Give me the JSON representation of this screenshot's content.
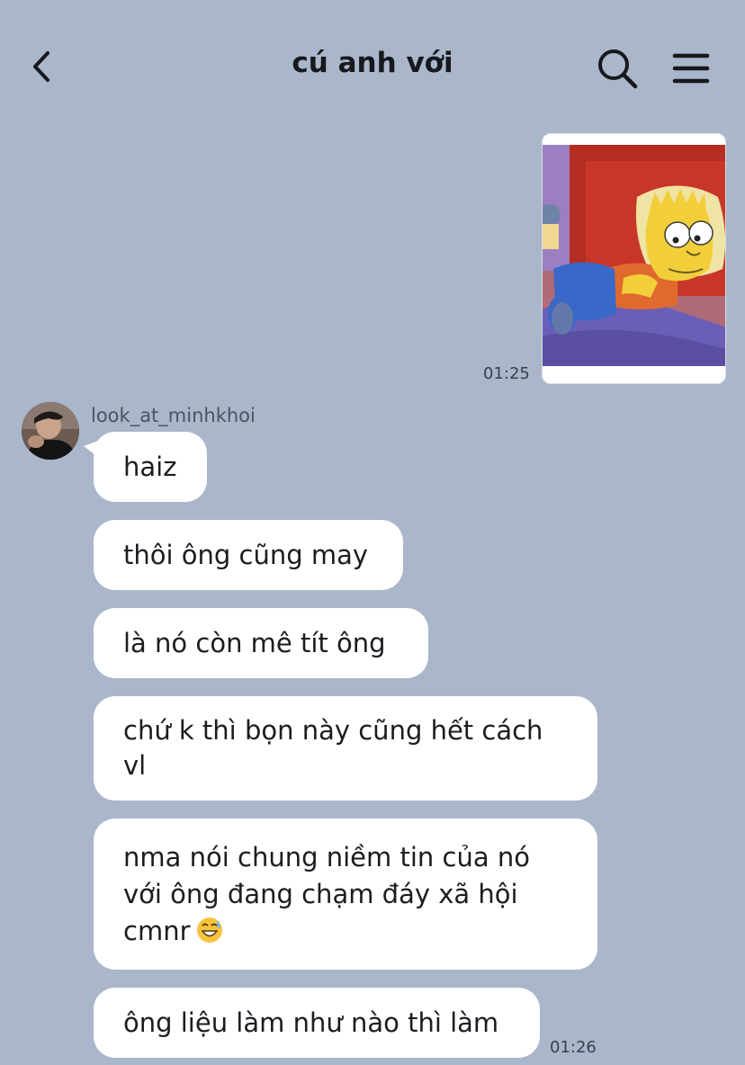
{
  "header": {
    "title": "cú anh với",
    "back_icon": "chevron-left-icon",
    "search_icon": "search-icon",
    "menu_icon": "hamburger-menu-icon"
  },
  "sent": {
    "image_alt": "cartoon-sticker",
    "time": "01:25"
  },
  "sender": {
    "name": "look_at_minhkhoi"
  },
  "messages": [
    {
      "text": "haiz"
    },
    {
      "text": "thôi ông cũng may"
    },
    {
      "text": "là nó còn mê tít ông"
    },
    {
      "text": "chứ k thì bọn này cũng hết cách vl"
    },
    {
      "text": "nma nói chung niềm tin của nó với ông đang chạm đáy xã hội cmnr",
      "emoji": "sweat-smile-emoji"
    },
    {
      "text": "ông liệu làm như nào thì làm"
    }
  ],
  "last_time": "01:26",
  "colors": {
    "background": "#aab6ca",
    "bubble": "#ffffff",
    "text": "#1b1d22"
  }
}
